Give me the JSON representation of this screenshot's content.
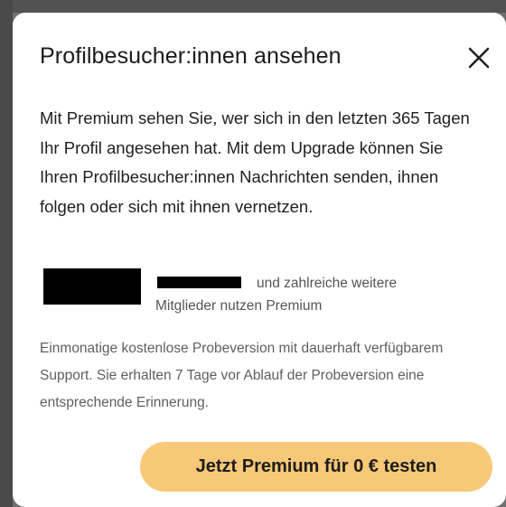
{
  "dialog": {
    "title": "Profilbesucher:innen ansehen",
    "close_icon": "close-icon",
    "body": "Mit Premium sehen Sie, wer sich in den letzten 365 Tagen Ihr Profil angesehen hat. Mit dem Upgrade können Sie Ihren Profilbesucher:innen Nachrichten senden, ihnen folgen oder sich mit ihnen vernetzen.",
    "members_text": "und zahlreiche weitere Mitglieder nutzen Premium",
    "trial_text": "Einmonatige kostenlose Probeversion mit dauerhaft verfügbarem Support. Sie erhalten 7 Tage vor Ablauf der Probeversion eine entsprechende Erinnerung.",
    "cta_label": "Jetzt Premium für 0 € testen"
  },
  "colors": {
    "cta_background": "#f7c878",
    "dialog_background": "#ffffff",
    "backdrop": "#6f6f6f"
  }
}
